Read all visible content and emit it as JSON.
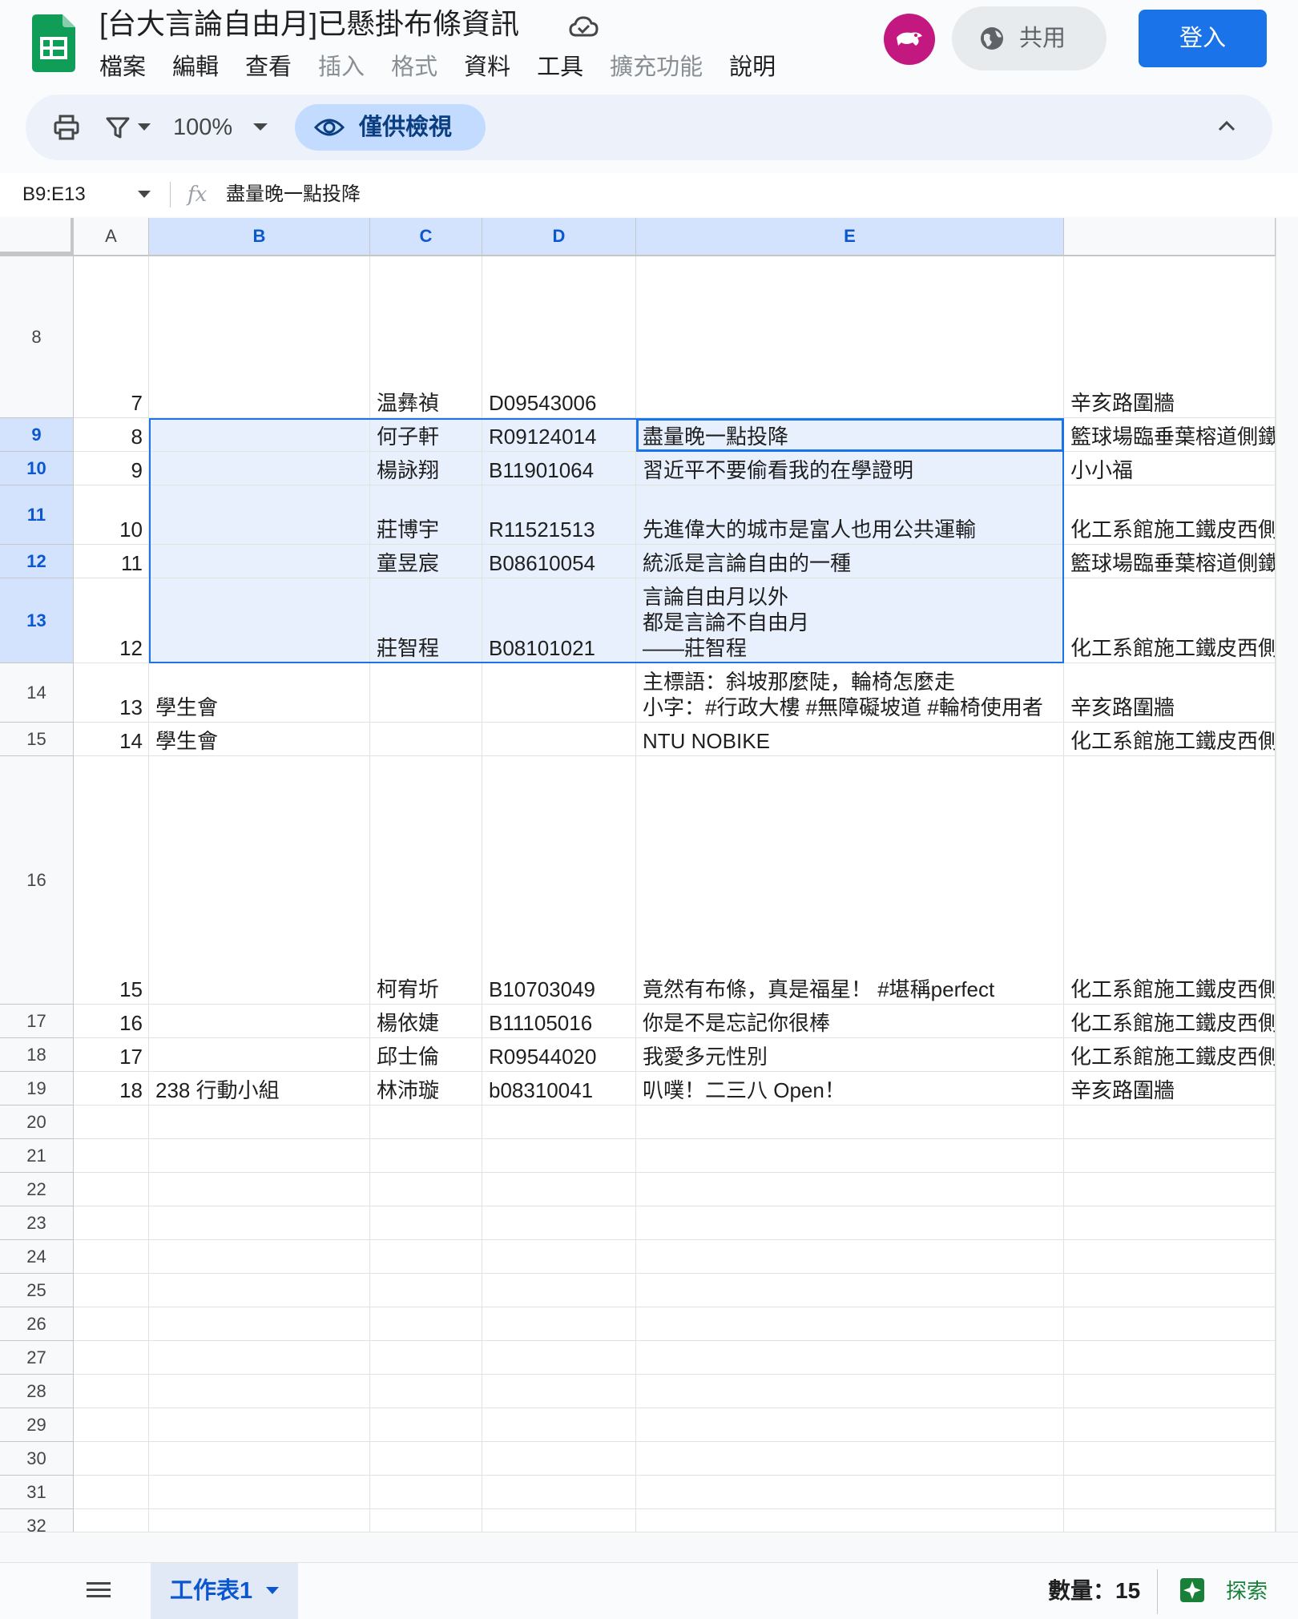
{
  "doc": {
    "title": "[台大言論自由月]已懸掛布條資訊"
  },
  "menu": [
    "檔案",
    "編輯",
    "查看",
    "插入",
    "格式",
    "資料",
    "工具",
    "擴充功能",
    "說明"
  ],
  "menu_disabled": [
    "插入",
    "格式",
    "擴充功能"
  ],
  "header": {
    "share_label": "共用",
    "login_label": "登入"
  },
  "toolbar": {
    "zoom": "100%",
    "view_only_label": "僅供檢視"
  },
  "formula_bar": {
    "name_box": "B9:E13",
    "fx": "fx",
    "value": "盡量晚一點投降"
  },
  "columns": [
    "A",
    "B",
    "C",
    "D",
    "E",
    ""
  ],
  "selected_columns": [
    "B",
    "C",
    "D",
    "E"
  ],
  "rows": [
    {
      "n": "8",
      "a": "7",
      "b": "",
      "c": "温彝禎",
      "d": "D09543006",
      "e": "",
      "f": "辛亥路圍牆"
    },
    {
      "n": "9",
      "a": "8",
      "b": "",
      "c": "何子軒",
      "d": "R09124014",
      "e": "盡量晚一點投降",
      "f": "籃球場臨垂葉榕道側鐵"
    },
    {
      "n": "10",
      "a": "9",
      "b": "",
      "c": "楊詠翔",
      "d": "B11901064",
      "e": "習近平不要偷看我的在學證明",
      "f": "小小福"
    },
    {
      "n": "11",
      "a": "10",
      "b": "",
      "c": "莊博宇",
      "d": "R11521513",
      "e": "先進偉大的城市是富人也用公共運輸",
      "f": "化工系館施工鐵皮西側"
    },
    {
      "n": "12",
      "a": "11",
      "b": "",
      "c": "童昱宸",
      "d": "B08610054",
      "e": "統派是言論自由的一種",
      "f": "籃球場臨垂葉榕道側鐵"
    },
    {
      "n": "13",
      "a": "12",
      "b": "",
      "c": "莊智程",
      "d": "B08101021",
      "e": "言論自由月以外\n都是言論不自由月\n——莊智程",
      "f": "化工系館施工鐵皮西側"
    },
    {
      "n": "14",
      "a": "13",
      "b": "學生會",
      "c": "",
      "d": "",
      "e": "主標語：斜坡那麼陡，輪椅怎麼走\n小字：#行政大樓 #無障礙坡道 #輪椅使用者",
      "f": "辛亥路圍牆"
    },
    {
      "n": "15",
      "a": "14",
      "b": "學生會",
      "c": "",
      "d": "",
      "e": "NTU NOBIKE",
      "f": "化工系館施工鐵皮西側"
    },
    {
      "n": "16",
      "a": "15",
      "b": "",
      "c": "柯宥圻",
      "d": "B10703049",
      "e": "竟然有布條，真是福星！ #堪稱perfect",
      "f": "化工系館施工鐵皮西側"
    },
    {
      "n": "17",
      "a": "16",
      "b": "",
      "c": "楊依婕",
      "d": "B11105016",
      "e": "你是不是忘記你很棒",
      "f": "化工系館施工鐵皮西側"
    },
    {
      "n": "18",
      "a": "17",
      "b": "",
      "c": "邱士倫",
      "d": "R09544020",
      "e": "我愛多元性別",
      "f": "化工系館施工鐵皮西側"
    },
    {
      "n": "19",
      "a": "18",
      "b": "238 行動小組",
      "c": "林沛璇",
      "d": "b08310041",
      "e": "叭噗！二三八 Open！",
      "f": "辛亥路圍牆"
    },
    {
      "n": "20",
      "a": "",
      "b": "",
      "c": "",
      "d": "",
      "e": "",
      "f": ""
    },
    {
      "n": "21",
      "a": "",
      "b": "",
      "c": "",
      "d": "",
      "e": "",
      "f": ""
    },
    {
      "n": "22",
      "a": "",
      "b": "",
      "c": "",
      "d": "",
      "e": "",
      "f": ""
    },
    {
      "n": "23",
      "a": "",
      "b": "",
      "c": "",
      "d": "",
      "e": "",
      "f": ""
    },
    {
      "n": "24",
      "a": "",
      "b": "",
      "c": "",
      "d": "",
      "e": "",
      "f": ""
    },
    {
      "n": "25",
      "a": "",
      "b": "",
      "c": "",
      "d": "",
      "e": "",
      "f": ""
    },
    {
      "n": "26",
      "a": "",
      "b": "",
      "c": "",
      "d": "",
      "e": "",
      "f": ""
    },
    {
      "n": "27",
      "a": "",
      "b": "",
      "c": "",
      "d": "",
      "e": "",
      "f": ""
    },
    {
      "n": "28",
      "a": "",
      "b": "",
      "c": "",
      "d": "",
      "e": "",
      "f": ""
    },
    {
      "n": "29",
      "a": "",
      "b": "",
      "c": "",
      "d": "",
      "e": "",
      "f": ""
    },
    {
      "n": "30",
      "a": "",
      "b": "",
      "c": "",
      "d": "",
      "e": "",
      "f": ""
    },
    {
      "n": "31",
      "a": "",
      "b": "",
      "c": "",
      "d": "",
      "e": "",
      "f": ""
    },
    {
      "n": "32",
      "a": "",
      "b": "",
      "c": "",
      "d": "",
      "e": "",
      "f": ""
    }
  ],
  "selected_rows": [
    "9",
    "10",
    "11",
    "12",
    "13"
  ],
  "active_cell": {
    "row": "9",
    "col": "E"
  },
  "bottom_bar": {
    "sheet_tab": "工作表1",
    "count": "數量：15",
    "explore_label": "探索"
  },
  "colors": {
    "accent": "#1a73e8",
    "selection_fill": "#e8f0fe",
    "header_selected": "#d3e3fd",
    "sheets_green": "#0f9d58",
    "avatar": "#c2187f"
  },
  "icons": [
    "sheets-logo-icon",
    "cloud-status-icon",
    "globe-icon",
    "print-icon",
    "filter-icon",
    "eye-icon",
    "chevron-up-icon",
    "fx-icon",
    "all-sheets-icon",
    "explore-icon"
  ]
}
